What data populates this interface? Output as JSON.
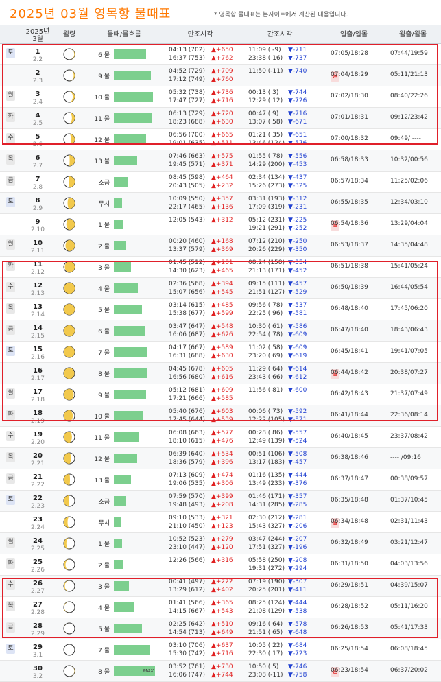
{
  "title": "2025년 03월 영목항 물때표",
  "note": "* 영목항 물때표는 본사이트에서 계산된 내용입니다.",
  "header": {
    "date_year": "2025년",
    "date_month": "3월",
    "moon": "월령",
    "tide_mul": "물때/물흐름",
    "high": "만조시각",
    "low": "간조시각",
    "sun": "일출/일몰",
    "moonrise": "월출/월몰"
  },
  "colors": {
    "red_box": "#e0202a",
    "bar": "#7ccf8e",
    "up": "#e02020",
    "down": "#2040d0",
    "title": "#ff7800"
  },
  "max_label": "MAX",
  "rows": [
    {
      "dow": "토",
      "day": "1",
      "lunar": "2.2",
      "mul": "6 물",
      "bar": 0.78,
      "high1": "04:13 (702)",
      "up1": "▲+650",
      "high2": "16:37 (753)",
      "up2": "▲+762",
      "low1": "11:09 ( -9)",
      "down1": "▼-711",
      "low2": "23:38 ( 16)",
      "down2": "▼-737",
      "sun": "07:05/18:28",
      "moon": "07:44/19:59",
      "phase": 0.07
    },
    {
      "dow": "일",
      "day": "2",
      "lunar": "2.3",
      "mul": "9 물",
      "bar": 0.9,
      "high1": "04:52 (729)",
      "up1": "▲+709",
      "high2": "17:12 (749)",
      "up2": "▲+760",
      "low1": "11:50 (-11)",
      "down1": "▼-740",
      "low2": "",
      "down2": "",
      "sun": "07:04/18:29",
      "moon": "05:11/21:13",
      "phase": 0.1
    },
    {
      "dow": "월",
      "day": "3",
      "lunar": "2.4",
      "mul": "10 물",
      "bar": 0.95,
      "high1": "05:32 (738)",
      "up1": "▲+736",
      "high2": "17:47 (727)",
      "up2": "▲+716",
      "low1": "00:13 ( 3)",
      "down1": "▼-744",
      "low2": "12:29 ( 12)",
      "down2": "▼-726",
      "sun": "07:02/18:30",
      "moon": "08:40/22:26",
      "phase": 0.14
    },
    {
      "dow": "화",
      "day": "4",
      "lunar": "2.5",
      "mul": "11 물",
      "bar": 0.92,
      "high1": "06:13 (729)",
      "up1": "▲+720",
      "high2": "18:23 (688)",
      "up2": "▲+630",
      "low1": "00:47 ( 9)",
      "down1": "▼-716",
      "low2": "13:07 ( 58)",
      "down2": "▼-671",
      "sun": "07:01/18:31",
      "moon": "09:12/23:42",
      "phase": 0.17
    },
    {
      "dow": "수",
      "day": "5",
      "lunar": "2.6",
      "mul": "12 물",
      "bar": 0.78,
      "high1": "06:56 (700)",
      "up1": "▲+665",
      "high2": "19:01 (635)",
      "up2": "▲+511",
      "low1": "01:21 ( 35)",
      "down1": "▼-651",
      "low2": "13:46 (124)",
      "down2": "▼-576",
      "sun": "07:00/18:32",
      "moon": "09:49/ ----",
      "phase": 0.2
    },
    {
      "dow": "목",
      "day": "6",
      "lunar": "2.7",
      "mul": "13 물",
      "bar": 0.56,
      "high1": "07:46 (663)",
      "up1": "▲+575",
      "high2": "19:45 (571)",
      "up2": "▲+371",
      "low1": "01:55 ( 78)",
      "down1": "▼-556",
      "low2": "14:29 (200)",
      "down2": "▼-453",
      "sun": "06:58/18:33",
      "moon": "10:32/00:56",
      "phase": 0.24
    },
    {
      "dow": "금",
      "day": "7",
      "lunar": "2.8",
      "mul": "조금",
      "bar": 0.35,
      "high1": "08:45 (598)",
      "up1": "▲+464",
      "high2": "20:43 (505)",
      "up2": "▲+232",
      "low1": "02:34 (134)",
      "down1": "▼-437",
      "low2": "15:26 (273)",
      "down2": "▼-325",
      "sun": "06:57/18:34",
      "moon": "11:25/02:06",
      "phase": 0.27
    },
    {
      "dow": "토",
      "day": "8",
      "lunar": "2.9",
      "mul": "무시",
      "bar": 0.2,
      "high1": "10:09 (550)",
      "up1": "▲+357",
      "high2": "22:17 (465)",
      "up2": "▲+136",
      "low1": "03:31 (193)",
      "down1": "▼-312",
      "low2": "17:09 (319)",
      "down2": "▼-231",
      "sun": "06:55/18:35",
      "moon": "12:34/03:10",
      "phase": 0.3
    },
    {
      "dow": "일",
      "day": "9",
      "lunar": "2.10",
      "mul": "1 물",
      "bar": 0.22,
      "high1": "12:05 (543)",
      "up1": "▲+312",
      "high2": "",
      "up2": "",
      "low1": "05:12 (231)",
      "down1": "▼-225",
      "low2": "19:21 (291)",
      "down2": "▼-252",
      "sun": "06:54/18:36",
      "moon": "13:29/04:04",
      "phase": 0.34
    },
    {
      "dow": "월",
      "day": "10",
      "lunar": "2.11",
      "mul": "2 물",
      "bar": 0.3,
      "high1": "00:20 (460)",
      "up1": "▲+168",
      "high2": "13:37 (579)",
      "up2": "▲+369",
      "low1": "07:12 (210)",
      "down1": "▼-250",
      "low2": "20:26 (229)",
      "down2": "▼-350",
      "sun": "06:53/18:37",
      "moon": "14:35/04:48",
      "phase": 0.37
    },
    {
      "dow": "화",
      "day": "11",
      "lunar": "2.12",
      "mul": "3 물",
      "bar": 0.42,
      "high1": "01:45 (512)",
      "up1": "▲+281",
      "high2": "14:30 (623)",
      "up2": "▲+465",
      "low1": "08:24 (158)",
      "down1": "▼-354",
      "low2": "21:13 (171)",
      "down2": "▼-452",
      "sun": "06:51/18:38",
      "moon": "15:41/05:24",
      "phase": 0.4
    },
    {
      "dow": "수",
      "day": "12",
      "lunar": "2.13",
      "mul": "4 물",
      "bar": 0.58,
      "high1": "02:36 (568)",
      "up1": "▲+394",
      "high2": "15:07 (656)",
      "up2": "▲+545",
      "low1": "09:15 (111)",
      "down1": "▼-457",
      "low2": "21:51 (127)",
      "down2": "▼-529",
      "sun": "06:50/18:39",
      "moon": "16:44/05:54",
      "phase": 0.44
    },
    {
      "dow": "목",
      "day": "13",
      "lunar": "2.14",
      "mul": "5 물",
      "bar": 0.68,
      "high1": "03:14 (615)",
      "up1": "▲+485",
      "high2": "15:38 (677)",
      "up2": "▲+599",
      "low1": "09:56 ( 78)",
      "down1": "▼-537",
      "low2": "22:25 ( 96)",
      "down2": "▼-581",
      "sun": "06:48/18:40",
      "moon": "17:45/06:20",
      "phase": 0.47
    },
    {
      "dow": "금",
      "day": "14",
      "lunar": "2.15",
      "mul": "6 물",
      "bar": 0.76,
      "high1": "03:47 (647)",
      "up1": "▲+548",
      "high2": "16:06 (687)",
      "up2": "▲+626",
      "low1": "10:30 ( 61)",
      "down1": "▼-586",
      "low2": "22:54 ( 78)",
      "down2": "▼-609",
      "sun": "06:47/18:40",
      "moon": "18:43/06:43",
      "phase": 0.5
    },
    {
      "dow": "토",
      "day": "15",
      "lunar": "2.16",
      "mul": "7 물",
      "bar": 0.8,
      "high1": "04:17 (667)",
      "up1": "▲+589",
      "high2": "16:31 (688)",
      "up2": "▲+630",
      "low1": "11:02 ( 58)",
      "down1": "▼-609",
      "low2": "23:20 ( 69)",
      "down2": "▼-619",
      "sun": "06:45/18:41",
      "moon": "19:41/07:05",
      "phase": 0.53
    },
    {
      "dow": "일",
      "day": "16",
      "lunar": "2.17",
      "mul": "8 물",
      "bar": 0.8,
      "high1": "04:45 (678)",
      "up1": "▲+605",
      "high2": "16:56 (680)",
      "up2": "▲+616",
      "low1": "11:29 ( 64)",
      "down1": "▼-614",
      "low2": "23:43 ( 66)",
      "down2": "▼-612",
      "sun": "06:44/18:42",
      "moon": "20:38/07:27",
      "phase": 0.56
    },
    {
      "dow": "월",
      "day": "17",
      "lunar": "2.18",
      "mul": "9 물",
      "bar": 0.78,
      "high1": "05:12 (681)",
      "up1": "▲+609",
      "high2": "17:21 (666)",
      "up2": "▲+585",
      "low1": "11:56 ( 81)",
      "down1": "▼-600",
      "low2": "",
      "down2": "",
      "sun": "06:42/18:43",
      "moon": "21:37/07:49",
      "phase": 0.6
    },
    {
      "dow": "화",
      "day": "18",
      "lunar": "2.19",
      "mul": "10 물",
      "bar": 0.72,
      "high1": "05:40 (676)",
      "up1": "▲+603",
      "high2": "17:45 (644)",
      "up2": "▲+539",
      "low1": "00:06 ( 73)",
      "down1": "▼-592",
      "low2": "12:22 (105)",
      "down2": "▼-571",
      "sun": "06:41/18:44",
      "moon": "22:36/08:14",
      "phase": 0.64
    },
    {
      "dow": "수",
      "day": "19",
      "lunar": "2.20",
      "mul": "11 물",
      "bar": 0.62,
      "high1": "06:08 (663)",
      "up1": "▲+577",
      "high2": "18:10 (615)",
      "up2": "▲+476",
      "low1": "00:28 ( 86)",
      "down1": "▼-557",
      "low2": "12:49 (139)",
      "down2": "▼-524",
      "sun": "06:40/18:45",
      "moon": "23:37/08:42",
      "phase": 0.67
    },
    {
      "dow": "목",
      "day": "20",
      "lunar": "2.21",
      "mul": "12 물",
      "bar": 0.56,
      "high1": "06:39 (640)",
      "up1": "▲+534",
      "high2": "18:36 (579)",
      "up2": "▲+396",
      "low1": "00:51 (106)",
      "down1": "▼-508",
      "low2": "13:17 (183)",
      "down2": "▼-457",
      "sun": "06:38/18:46",
      "moon": "---- /09:16",
      "phase": 0.7
    },
    {
      "dow": "금",
      "day": "21",
      "lunar": "2.22",
      "mul": "13 물",
      "bar": 0.42,
      "high1": "07:13 (609)",
      "up1": "▲+474",
      "high2": "19:06 (535)",
      "up2": "▲+306",
      "low1": "01:16 (135)",
      "down1": "▼-444",
      "low2": "13:49 (233)",
      "down2": "▼-376",
      "sun": "06:37/18:47",
      "moon": "00:38/09:57",
      "phase": 0.73
    },
    {
      "dow": "토",
      "day": "22",
      "lunar": "2.23",
      "mul": "조금",
      "bar": 0.3,
      "high1": "07:59 (570)",
      "up1": "▲+399",
      "high2": "19:48 (493)",
      "up2": "▲+208",
      "low1": "01:46 (171)",
      "down1": "▼-357",
      "low2": "14:31 (285)",
      "down2": "▼-285",
      "sun": "06:35/18:48",
      "moon": "01:37/10:45",
      "phase": 0.77
    },
    {
      "dow": "일",
      "day": "23",
      "lunar": "2.24",
      "mul": "무시",
      "bar": 0.16,
      "high1": "09:10 (533)",
      "up1": "▲+321",
      "high2": "21:10 (450)",
      "up2": "▲+123",
      "low1": "02:30 (212)",
      "down1": "▼-281",
      "low2": "15:43 (327)",
      "down2": "▼-206",
      "sun": "06:34/18:48",
      "moon": "02:31/11:43",
      "phase": 0.8
    },
    {
      "dow": "월",
      "day": "24",
      "lunar": "2.25",
      "mul": "1 물",
      "bar": 0.2,
      "high1": "10:52 (523)",
      "up1": "▲+279",
      "high2": "23:10 (447)",
      "up2": "▲+120",
      "low1": "03:47 (244)",
      "down1": "▼-207",
      "low2": "17:51 (327)",
      "down2": "▼-196",
      "sun": "06:32/18:49",
      "moon": "03:21/12:47",
      "phase": 0.84
    },
    {
      "dow": "화",
      "day": "25",
      "lunar": "2.26",
      "mul": "2 물",
      "bar": 0.24,
      "high1": "12:26 (566)",
      "up1": "▲+316",
      "high2": "",
      "up2": "",
      "low1": "05:58 (250)",
      "down1": "▼-208",
      "low2": "19:31 (272)",
      "down2": "▼-294",
      "sun": "06:31/18:50",
      "moon": "04:03/13:56",
      "phase": 0.87
    },
    {
      "dow": "수",
      "day": "26",
      "lunar": "2.27",
      "mul": "3 물",
      "bar": 0.36,
      "high1": "00:41 (497)",
      "up1": "▲+222",
      "high2": "13:29 (612)",
      "up2": "▲+402",
      "low1": "07:19 (190)",
      "down1": "▼-307",
      "low2": "20:25 (201)",
      "down2": "▼-411",
      "sun": "06:29/18:51",
      "moon": "04:39/15:07",
      "phase": 0.9
    },
    {
      "dow": "목",
      "day": "27",
      "lunar": "2.28",
      "mul": "4 물",
      "bar": 0.5,
      "high1": "01:41 (566)",
      "up1": "▲+365",
      "high2": "14:15 (667)",
      "up2": "▲+543",
      "low1": "08:25 (124)",
      "down1": "▼-444",
      "low2": "21:08 (129)",
      "down2": "▼-538",
      "sun": "06:28/18:52",
      "moon": "05:11/16:20",
      "phase": 0.93
    },
    {
      "dow": "금",
      "day": "28",
      "lunar": "2.29",
      "mul": "5 물",
      "bar": 0.68,
      "high1": "02:25 (642)",
      "up1": "▲+510",
      "high2": "14:54 (713)",
      "up2": "▲+649",
      "low1": "09:16 ( 64)",
      "down1": "▼-578",
      "low2": "21:51 ( 65)",
      "down2": "▼-648",
      "sun": "06:26/18:53",
      "moon": "05:41/17:33",
      "phase": 0.97
    },
    {
      "dow": "토",
      "day": "29",
      "lunar": "3.1",
      "mul": "7 물",
      "bar": 0.88,
      "high1": "03:10 (706)",
      "up1": "▲+637",
      "high2": "15:30 (742)",
      "up2": "▲+716",
      "low1": "10:05 ( 22)",
      "down1": "▼-684",
      "low2": "22:30 ( 17)",
      "down2": "▼-723",
      "sun": "06:25/18:54",
      "moon": "06:08/18:45",
      "phase": 0.01
    },
    {
      "dow": "일",
      "day": "30",
      "lunar": "3.2",
      "mul": "8 물",
      "bar": 1.0,
      "high1": "03:52 (761)",
      "up1": "▲+730",
      "high2": "16:06 (747)",
      "up2": "▲+744",
      "low1": "10:50 ( 5)",
      "down1": "▼-746",
      "low2": "23:08 (-11)",
      "down2": "▼-758",
      "sun": "06:23/18:54",
      "moon": "06:37/20:02",
      "phase": 0.05,
      "max": true
    }
  ]
}
